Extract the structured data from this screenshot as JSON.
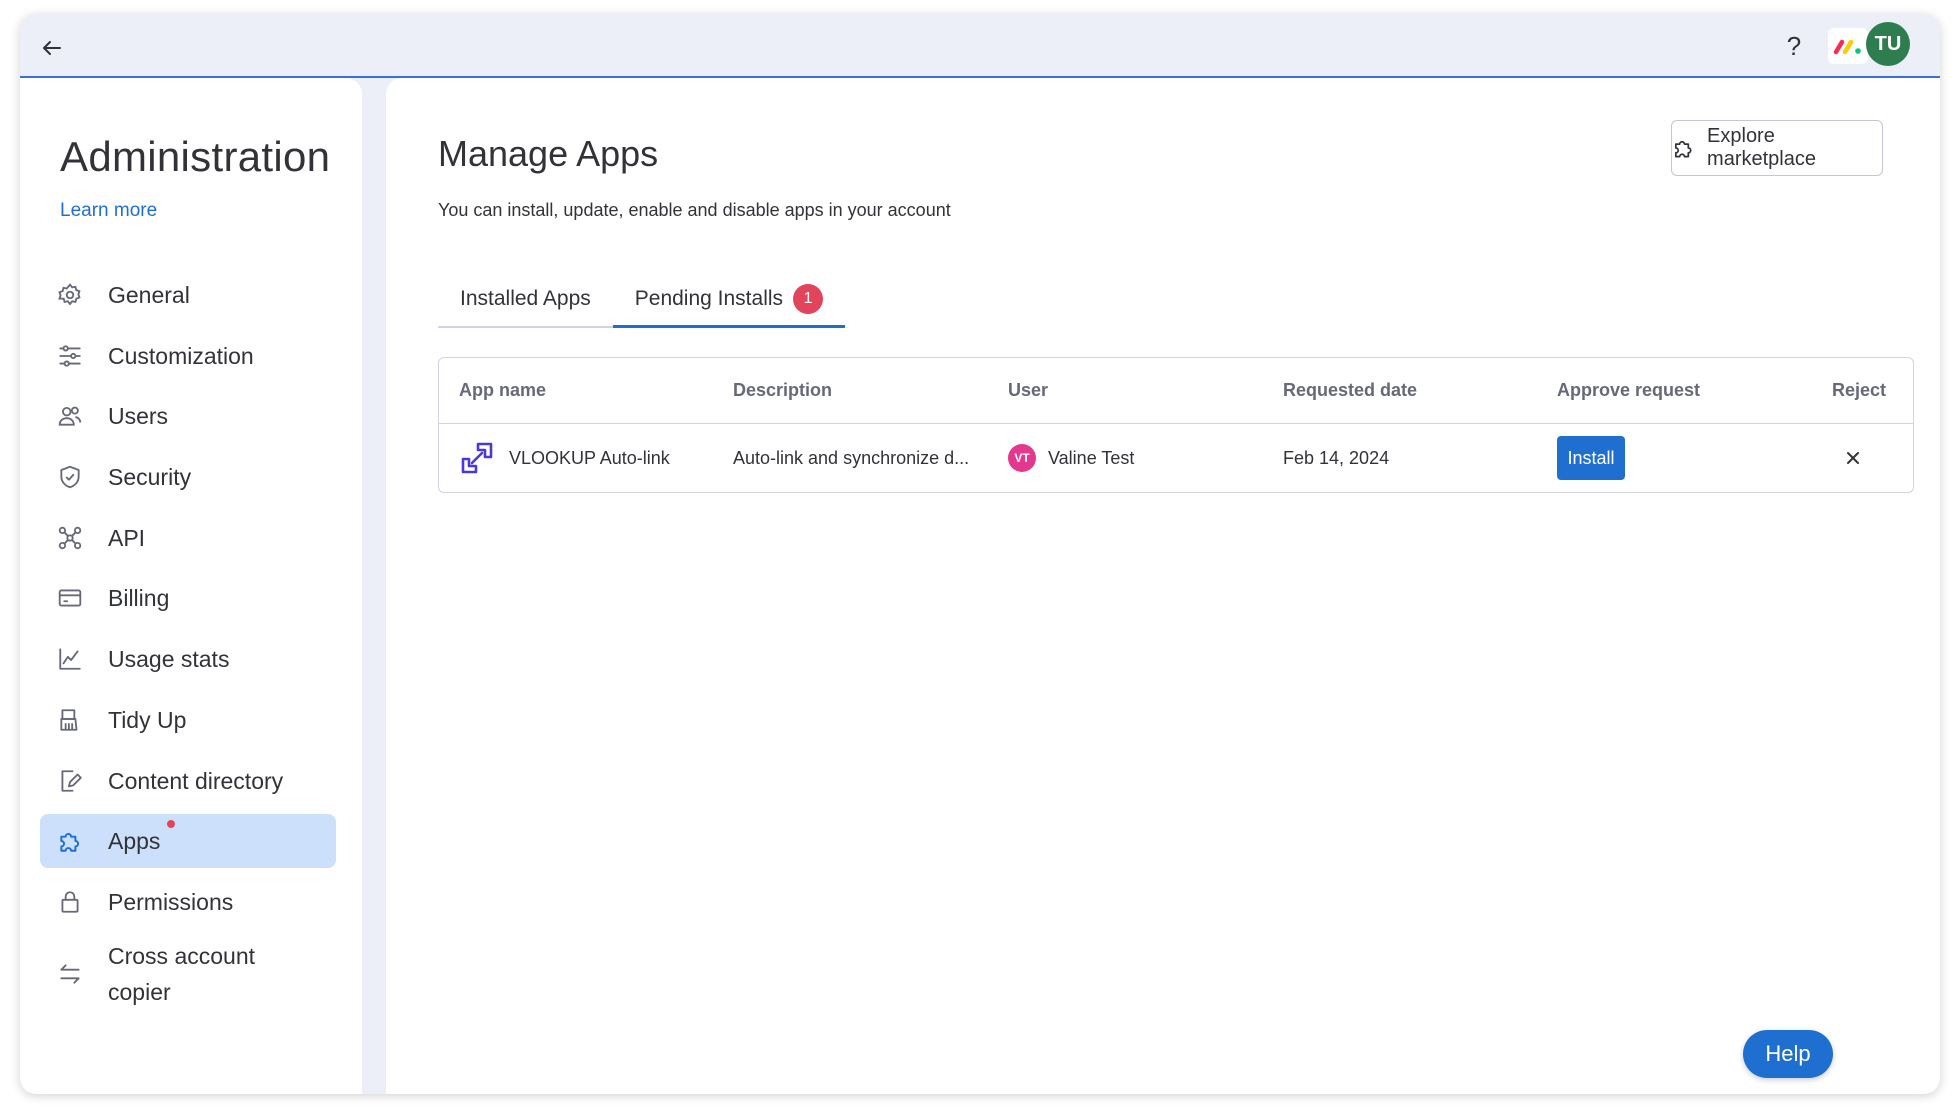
{
  "topbar": {
    "help_symbol": "?",
    "user_initials": "TU",
    "icons": {
      "back": "arrow-left-icon",
      "brand": "monday-logo-icon"
    }
  },
  "sidebar": {
    "title": "Administration",
    "learn_more": "Learn more",
    "items": [
      {
        "label": "General",
        "icon": "gear-icon"
      },
      {
        "label": "Customization",
        "icon": "sliders-icon"
      },
      {
        "label": "Users",
        "icon": "users-icon"
      },
      {
        "label": "Security",
        "icon": "shield-icon"
      },
      {
        "label": "API",
        "icon": "api-icon"
      },
      {
        "label": "Billing",
        "icon": "credit-card-icon"
      },
      {
        "label": "Usage stats",
        "icon": "chart-icon"
      },
      {
        "label": "Tidy Up",
        "icon": "broom-icon"
      },
      {
        "label": "Content directory",
        "icon": "edit-document-icon"
      },
      {
        "label": "Apps",
        "icon": "puzzle-icon",
        "active": true,
        "has_notification_dot": true
      },
      {
        "label": "Permissions",
        "icon": "lock-icon"
      },
      {
        "label": "Cross account copier",
        "icon": "transfer-icon"
      }
    ]
  },
  "main": {
    "title": "Manage Apps",
    "subtitle": "You can install, update, enable and disable apps in your account",
    "explore_button": "Explore marketplace",
    "tabs": [
      {
        "label": "Installed Apps",
        "active": false
      },
      {
        "label": "Pending Installs",
        "active": true,
        "badge": "1"
      }
    ],
    "table": {
      "columns": [
        "App name",
        "Description",
        "User",
        "Requested date",
        "Approve request",
        "Reject"
      ],
      "rows": [
        {
          "app_name": "VLOOKUP Auto-link",
          "description": "Auto-link and synchronize d...",
          "user_initials": "VT",
          "user_name": "Valine Test",
          "requested_date": "Feb 14, 2024",
          "approve_label": "Install",
          "reject_symbol": "×"
        }
      ]
    }
  },
  "help_button": "Help",
  "colors": {
    "accent": "#1f6fd1",
    "badge_red": "#e2445c",
    "active_nav_bg": "#cce0fb",
    "user_avatar_pink": "#e2388e",
    "top_avatar_green": "#2e7d4f"
  }
}
